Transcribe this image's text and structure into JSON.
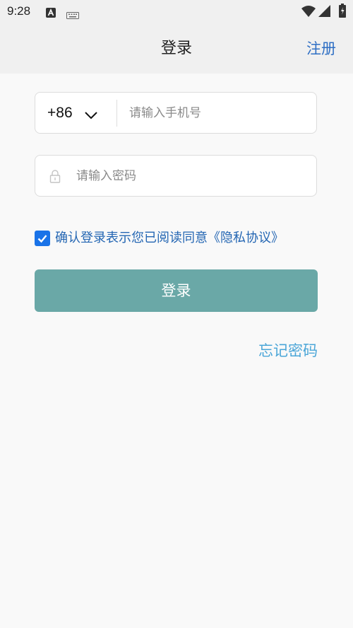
{
  "status_bar": {
    "time": "9:28",
    "notification_icon": "a-letter-icon",
    "keyboard_icon": "keyboard-icon",
    "wifi_icon": "wifi-icon",
    "signal_icon": "signal-icon",
    "battery_icon": "battery-icon"
  },
  "header": {
    "title": "登录",
    "register_label": "注册"
  },
  "form": {
    "country_code": "+86",
    "phone_placeholder": "请输入手机号",
    "password_placeholder": "请输入密码",
    "agreement_text": "确认登录表示您已阅读同意",
    "agreement_link": "《隐私协议》",
    "agreement_checked": true,
    "login_button_label": "登录",
    "forgot_password_label": "忘记密码"
  },
  "colors": {
    "accent": "#1a73e8",
    "login_button": "#6aa8a7",
    "link": "#2f6fc4",
    "forgot_link": "#4ba6d8",
    "background": "#f9f9f9"
  }
}
